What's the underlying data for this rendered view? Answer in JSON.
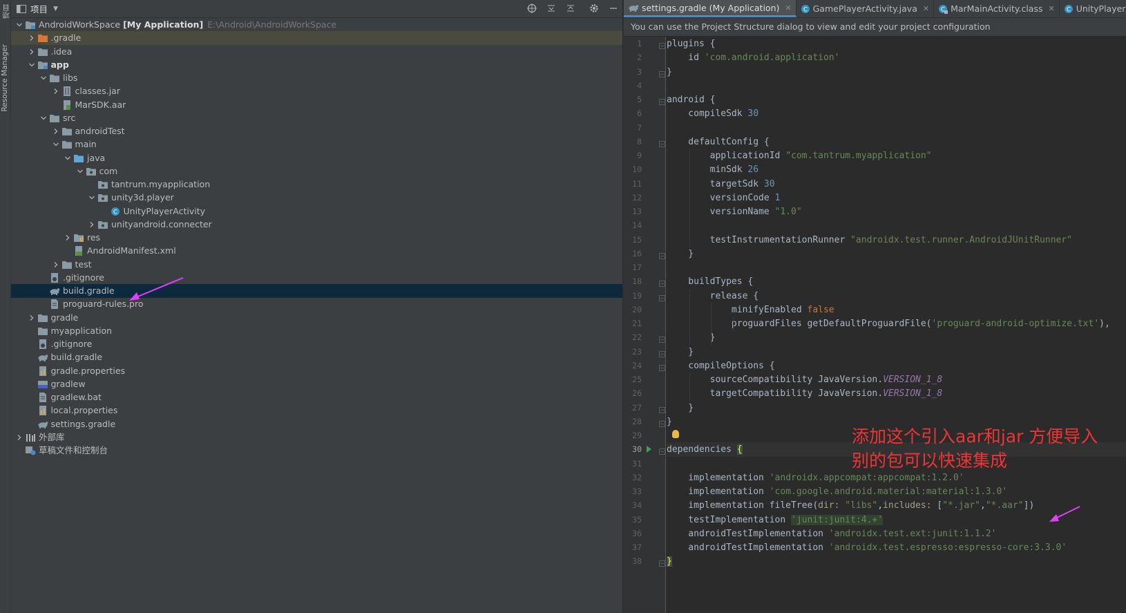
{
  "toolstrip": {
    "project_tab": "项目",
    "resource_manager_tab": "Resource Manager"
  },
  "project_panel": {
    "title": "项目",
    "header_icons": [
      "locate-icon",
      "expand-all-icon",
      "collapse-all-icon",
      "gear-icon",
      "minimize-icon"
    ],
    "tree": [
      {
        "label": "AndroidWorkSpace",
        "bold_suffix": "[My Application]",
        "path": "E:\\Android\\AndroidWorkSpace",
        "level": 0,
        "chevron": "down",
        "icon": "module-folder"
      },
      {
        "label": ".gradle",
        "level": 1,
        "chevron": "right",
        "icon": "folder-orange",
        "highlight": true
      },
      {
        "label": ".idea",
        "level": 1,
        "chevron": "right",
        "icon": "folder"
      },
      {
        "label": "app",
        "level": 1,
        "chevron": "down",
        "icon": "module-folder",
        "bold": true
      },
      {
        "label": "libs",
        "level": 2,
        "chevron": "down",
        "icon": "folder"
      },
      {
        "label": "classes.jar",
        "level": 3,
        "chevron": "right",
        "icon": "jar"
      },
      {
        "label": "MarSDK.aar",
        "level": 3,
        "chevron": "",
        "icon": "aar"
      },
      {
        "label": "src",
        "level": 2,
        "chevron": "down",
        "icon": "folder"
      },
      {
        "label": "androidTest",
        "level": 3,
        "chevron": "right",
        "icon": "folder"
      },
      {
        "label": "main",
        "level": 3,
        "chevron": "down",
        "icon": "folder"
      },
      {
        "label": "java",
        "level": 4,
        "chevron": "down",
        "icon": "folder-blue"
      },
      {
        "label": "com",
        "level": 5,
        "chevron": "down",
        "icon": "package"
      },
      {
        "label": "tantrum.myapplication",
        "level": 6,
        "chevron": "",
        "icon": "package"
      },
      {
        "label": "unity3d.player",
        "level": 6,
        "chevron": "down",
        "icon": "package"
      },
      {
        "label": "UnityPlayerActivity",
        "level": 7,
        "chevron": "",
        "icon": "class"
      },
      {
        "label": "unityandroid.connecter",
        "level": 6,
        "chevron": "right",
        "icon": "package"
      },
      {
        "label": "res",
        "level": 4,
        "chevron": "right",
        "icon": "res-folder"
      },
      {
        "label": "AndroidManifest.xml",
        "level": 4,
        "chevron": "",
        "icon": "manifest"
      },
      {
        "label": "test",
        "level": 3,
        "chevron": "right",
        "icon": "folder"
      },
      {
        "label": ".gitignore",
        "level": 2,
        "chevron": "",
        "icon": "gitignore"
      },
      {
        "label": "build.gradle",
        "level": 2,
        "chevron": "",
        "icon": "gradle",
        "selected": true
      },
      {
        "label": "proguard-rules.pro",
        "level": 2,
        "chevron": "",
        "icon": "text-file"
      },
      {
        "label": "gradle",
        "level": 1,
        "chevron": "right",
        "icon": "folder"
      },
      {
        "label": "myapplication",
        "level": 1,
        "chevron": "",
        "icon": "folder"
      },
      {
        "label": ".gitignore",
        "level": 1,
        "chevron": "",
        "icon": "gitignore"
      },
      {
        "label": "build.gradle",
        "level": 1,
        "chevron": "",
        "icon": "gradle"
      },
      {
        "label": "gradle.properties",
        "level": 1,
        "chevron": "",
        "icon": "properties"
      },
      {
        "label": "gradlew",
        "level": 1,
        "chevron": "",
        "icon": "shell"
      },
      {
        "label": "gradlew.bat",
        "level": 1,
        "chevron": "",
        "icon": "text-file"
      },
      {
        "label": "local.properties",
        "level": 1,
        "chevron": "",
        "icon": "properties"
      },
      {
        "label": "settings.gradle",
        "level": 1,
        "chevron": "",
        "icon": "gradle"
      },
      {
        "label": "外部库",
        "level": 0,
        "chevron": "right",
        "icon": "library"
      },
      {
        "label": "草稿文件和控制台",
        "level": 0,
        "chevron": "",
        "icon": "scratch"
      }
    ]
  },
  "editor": {
    "tabs": [
      {
        "label": "settings.gradle (My Application)",
        "icon": "gradle",
        "active": true
      },
      {
        "label": "GamePlayerActivity.java",
        "icon": "class"
      },
      {
        "label": "MarMainActivity.class",
        "icon": "class-compiled"
      },
      {
        "label": "UnityPlayerActivity",
        "icon": "class"
      }
    ],
    "banner": "You can use the Project Structure dialog to view and edit your project configuration",
    "current_line": 30,
    "lines": [
      [
        [
          "p",
          "plugins {"
        ]
      ],
      [
        [
          "p",
          "    id "
        ],
        [
          "s",
          "'com.android.application'"
        ]
      ],
      [
        [
          "p",
          "}"
        ]
      ],
      [],
      [
        [
          "p",
          "android {"
        ]
      ],
      [
        [
          "p",
          "    compileSdk "
        ],
        [
          "n",
          "30"
        ]
      ],
      [],
      [
        [
          "p",
          "    defaultConfig {"
        ]
      ],
      [
        [
          "p",
          "        applicationId "
        ],
        [
          "s",
          "\"com.tantrum.myapplication\""
        ]
      ],
      [
        [
          "p",
          "        minSdk "
        ],
        [
          "n",
          "26"
        ]
      ],
      [
        [
          "p",
          "        targetSdk "
        ],
        [
          "n",
          "30"
        ]
      ],
      [
        [
          "p",
          "        versionCode "
        ],
        [
          "n",
          "1"
        ]
      ],
      [
        [
          "p",
          "        versionName "
        ],
        [
          "s",
          "\"1.0\""
        ]
      ],
      [],
      [
        [
          "p",
          "        testInstrumentationRunner "
        ],
        [
          "s",
          "\"androidx.test.runner.AndroidJUnitRunner\""
        ]
      ],
      [
        [
          "p",
          "    }"
        ]
      ],
      [],
      [
        [
          "p",
          "    buildTypes {"
        ]
      ],
      [
        [
          "p",
          "        release {"
        ]
      ],
      [
        [
          "p",
          "            minifyEnabled "
        ],
        [
          "k",
          "false"
        ]
      ],
      [
        [
          "p",
          "            proguardFiles getDefaultProguardFile("
        ],
        [
          "s",
          "'proguard-android-optimize.txt'"
        ],
        [
          "p",
          "),"
        ]
      ],
      [
        [
          "p",
          "        }"
        ]
      ],
      [
        [
          "p",
          "    }"
        ]
      ],
      [
        [
          "p",
          "    compileOptions {"
        ]
      ],
      [
        [
          "p",
          "        sourceCompatibility JavaVersion."
        ],
        [
          "st",
          "VERSION_1_8"
        ]
      ],
      [
        [
          "p",
          "        targetCompatibility JavaVersion."
        ],
        [
          "st",
          "VERSION_1_8"
        ]
      ],
      [
        [
          "p",
          "    }"
        ]
      ],
      [
        [
          "p",
          "}"
        ]
      ],
      [],
      [
        [
          "p",
          "dependencies "
        ],
        [
          "bh",
          "{"
        ]
      ],
      [],
      [
        [
          "p",
          "    implementation "
        ],
        [
          "s",
          "'androidx.appcompat:appcompat:1.2.0'"
        ]
      ],
      [
        [
          "p",
          "    implementation "
        ],
        [
          "s",
          "'com.google.android.material:material:1.3.0'"
        ]
      ],
      [
        [
          "p",
          "    implementation fileTree("
        ],
        [
          "pa",
          "dir: "
        ],
        [
          "s",
          "\"libs\""
        ],
        [
          "p",
          ","
        ],
        [
          "pa",
          "includes: "
        ],
        [
          "p",
          "["
        ],
        [
          "s",
          "\"*.jar\""
        ],
        [
          "p",
          ","
        ],
        [
          "s",
          "\"*.aar\""
        ],
        [
          "p",
          "])"
        ]
      ],
      [
        [
          "p",
          "    testImplementation "
        ],
        [
          "sh",
          "'junit:junit:4.+'"
        ]
      ],
      [
        [
          "p",
          "    androidTestImplementation "
        ],
        [
          "s",
          "'androidx.test.ext:junit:1.1.2'"
        ]
      ],
      [
        [
          "p",
          "    androidTestImplementation "
        ],
        [
          "s",
          "'androidx.test.espresso:espresso-core:3.3.0'"
        ]
      ],
      [
        [
          "bh",
          "}"
        ]
      ]
    ]
  },
  "annotation": {
    "note_line1": "添加这个引入aar和jar 方便导入",
    "note_line2": "别的包可以快速集成",
    "color": "#ee3535",
    "arrow_color": "#e040fb"
  },
  "colors": {
    "keyword": "#cc7832",
    "string": "#6a8759",
    "number": "#6897bb",
    "static_field": "#9876aa",
    "text": "#a9b7c6",
    "selection": "#0d293e"
  }
}
